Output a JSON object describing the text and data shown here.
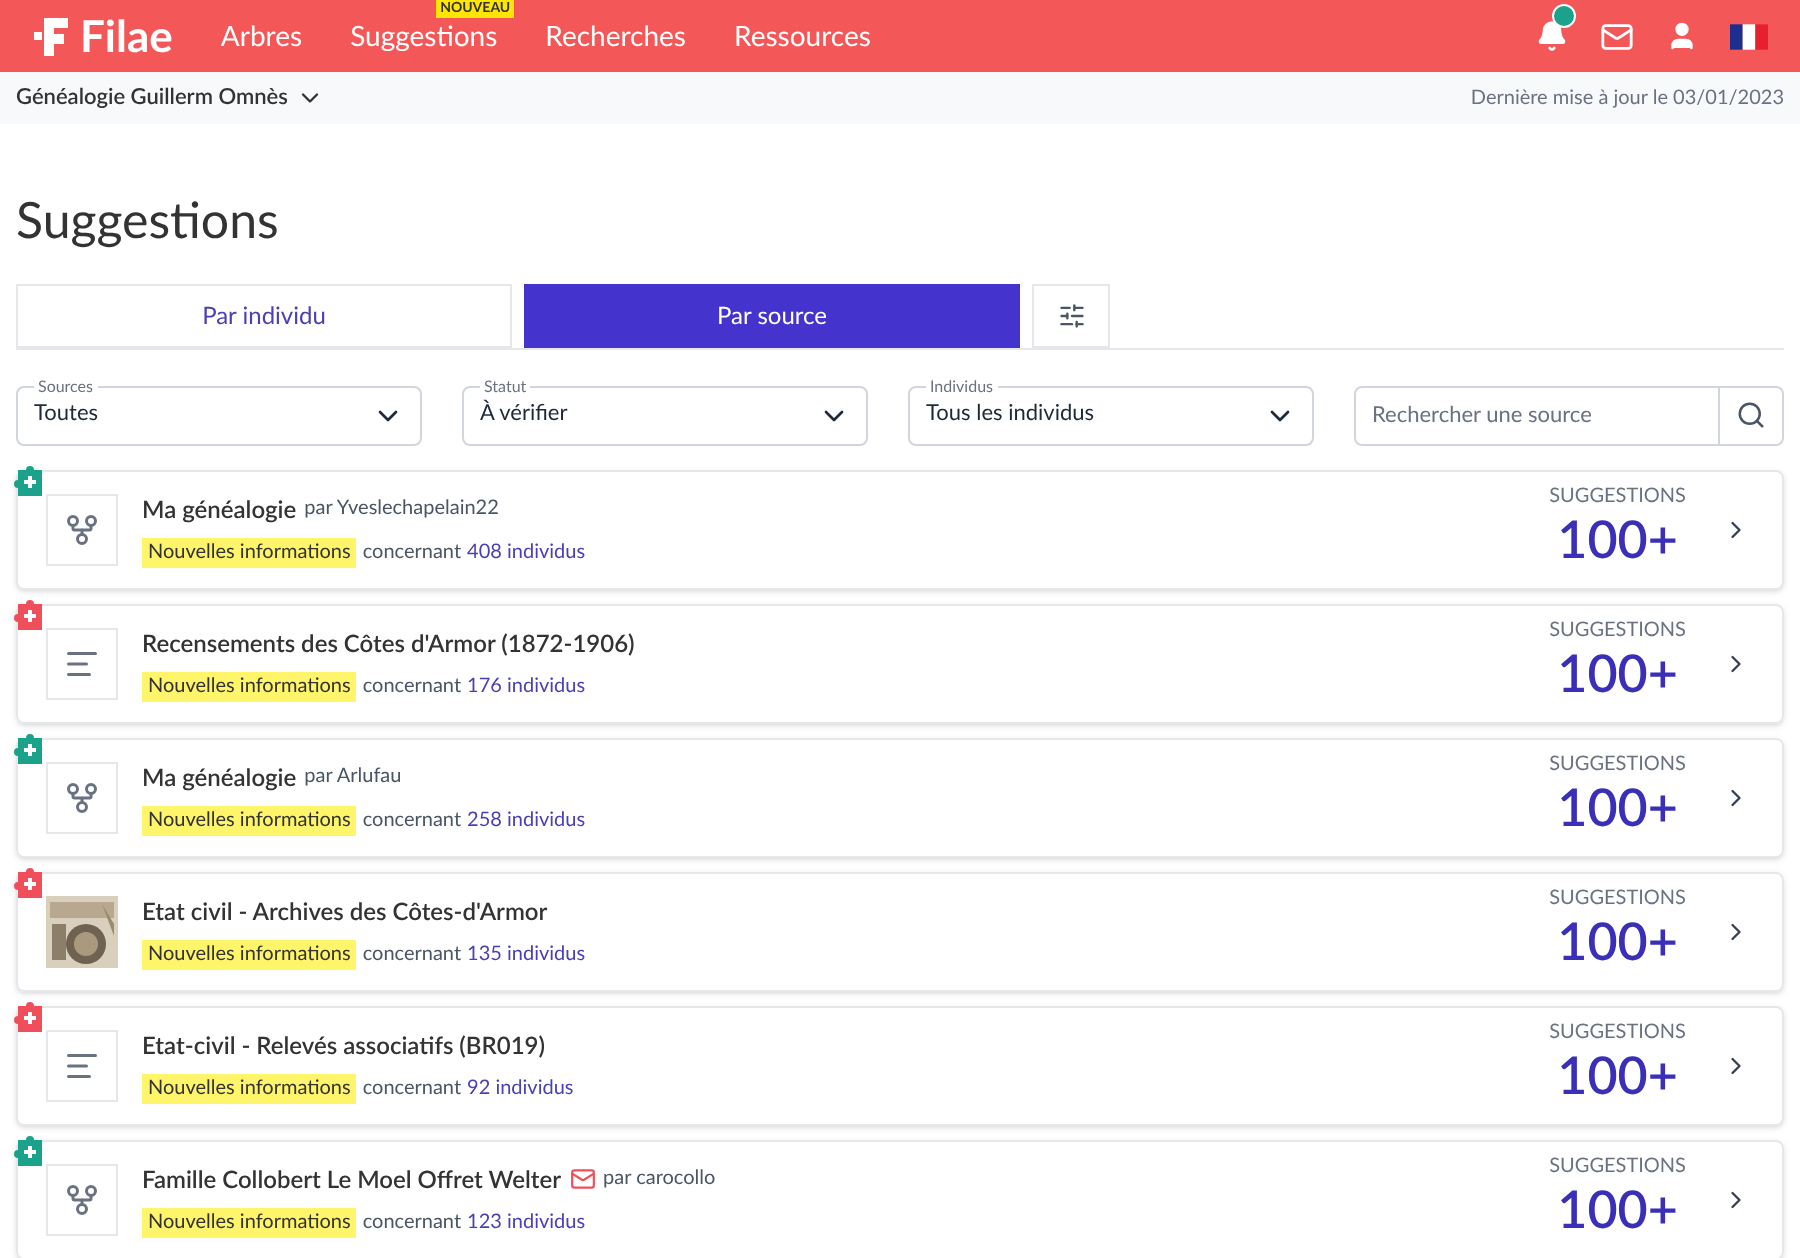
{
  "nav": {
    "logo": "Filae",
    "items": [
      {
        "label": "Arbres"
      },
      {
        "label": "Suggestions",
        "badge": "NOUVEAU"
      },
      {
        "label": "Recherches"
      },
      {
        "label": "Ressources"
      }
    ],
    "notification_dot": true
  },
  "subbar": {
    "tree": "Généalogie Guillerm Omnès",
    "updated": "Dernière mise à jour le 03/01/2023"
  },
  "title": "Suggestions",
  "tabs": [
    {
      "label": "Par individu",
      "selected": false
    },
    {
      "label": "Par source",
      "selected": true
    }
  ],
  "filters": [
    {
      "label": "Sources",
      "value": "Toutes"
    },
    {
      "label": "Statut",
      "value": "À vérifier"
    },
    {
      "label": "Individus",
      "value": "Tous les individus"
    }
  ],
  "search": {
    "placeholder": "Rechercher une source"
  },
  "sources": [
    {
      "kind": "tree",
      "color": "#1aa38a",
      "title": "Ma généalogie",
      "mail": false,
      "by": "par Yveslechapelain22",
      "tag": "Nouvelles informations",
      "about": "concernant",
      "count": "408 individus",
      "label": "SUGGESTIONS",
      "total": "100+"
    },
    {
      "kind": "document",
      "color": "#f04e5a",
      "title": "Recensements des Côtes d'Armor (1872-1906)",
      "mail": false,
      "tag": "Nouvelles informations",
      "about": "concernant",
      "count": "176 individus",
      "label": "SUGGESTIONS",
      "total": "100+"
    },
    {
      "kind": "tree",
      "color": "#1aa38a",
      "title": "Ma généalogie",
      "mail": false,
      "by": "par Arlufau",
      "tag": "Nouvelles informations",
      "about": "concernant",
      "count": "258 individus",
      "label": "SUGGESTIONS",
      "total": "100+"
    },
    {
      "kind": "picture",
      "color": "#f04e5a",
      "title": "Etat civil - Archives des Côtes-d'Armor",
      "mail": false,
      "tag": "Nouvelles informations",
      "about": "concernant",
      "count": "135 individus",
      "label": "SUGGESTIONS",
      "total": "100+"
    },
    {
      "kind": "document",
      "color": "#f04e5a",
      "title": "Etat-civil - Relevés associatifs (BR019)",
      "mail": false,
      "tag": "Nouvelles informations",
      "about": "concernant",
      "count": "92 individus",
      "label": "SUGGESTIONS",
      "total": "100+"
    },
    {
      "kind": "tree",
      "color": "#1aa38a",
      "title": "Famille Collobert Le Moel Offret Welter",
      "mail": true,
      "by": "par carocollo",
      "tag": "Nouvelles informations",
      "about": "concernant",
      "count": "123 individus",
      "label": "SUGGESTIONS",
      "total": "100+"
    }
  ]
}
